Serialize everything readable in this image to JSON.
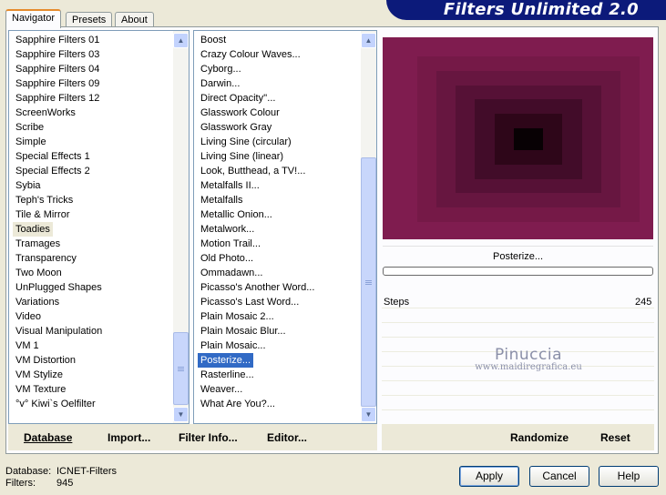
{
  "title": "Filters Unlimited 2.0",
  "tabs": [
    "Navigator",
    "Presets",
    "About"
  ],
  "categories": [
    "Sapphire Filters 01",
    "Sapphire Filters 03",
    "Sapphire Filters 04",
    "Sapphire Filters 09",
    "Sapphire Filters 12",
    "ScreenWorks",
    "Scribe",
    "Simple",
    "Special Effects 1",
    "Special Effects 2",
    "Sybia",
    "Teph's Tricks",
    "Tile & Mirror",
    "Toadies",
    "Tramages",
    "Transparency",
    "Two Moon",
    "UnPlugged Shapes",
    "Variations",
    "Video",
    "Visual Manipulation",
    "VM 1",
    "VM Distortion",
    "VM Stylize",
    "VM Texture",
    "°v° Kiwi`s Oelfilter"
  ],
  "selected_category": "Toadies",
  "filters": [
    "Boost",
    "Crazy Colour Waves...",
    "Cyborg...",
    "Darwin...",
    "Direct Opacity''...",
    "Glasswork Colour",
    "Glasswork Gray",
    "Living Sine (circular)",
    "Living Sine (linear)",
    "Look, Butthead, a TV!...",
    "Metalfalls II...",
    "Metalfalls",
    "Metallic Onion...",
    "Metalwork...",
    "Motion Trail...",
    "Old Photo...",
    "Ommadawn...",
    "Picasso's Another Word...",
    "Picasso's Last Word...",
    "Plain Mosaic 2...",
    "Plain Mosaic Blur...",
    "Plain Mosaic...",
    "Posterize...",
    "Rasterline...",
    "Weaver...",
    "What Are You?..."
  ],
  "selected_filter": "Posterize...",
  "current_filter": "Posterize...",
  "param": {
    "label": "Steps",
    "value": "245"
  },
  "watermark": {
    "name": "Pinuccia",
    "url": "www.maidiregrafica.eu"
  },
  "left_actions": [
    "Database",
    "Import...",
    "Filter Info...",
    "Editor..."
  ],
  "right_actions": [
    "Randomize",
    "Reset"
  ],
  "status": {
    "database_label": "Database:",
    "database_value": "ICNET-Filters",
    "filters_label": "Filters:",
    "filters_value": "945"
  },
  "buttons": {
    "apply": "Apply",
    "cancel": "Cancel",
    "help": "Help"
  },
  "preview_colors": [
    "#7f1c4f",
    "#751947",
    "#671640",
    "#561136",
    "#420c29",
    "#2e0619",
    "#080104"
  ],
  "icons": {
    "scroll_up": "scroll-up-icon",
    "scroll_down": "scroll-down-icon"
  }
}
